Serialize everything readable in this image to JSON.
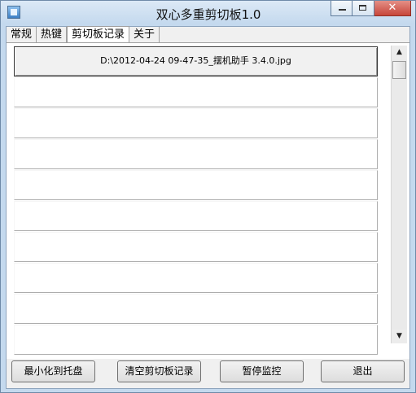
{
  "window": {
    "title": "双心多重剪切板1.0",
    "close_glyph": "✕"
  },
  "tabs": [
    {
      "label": "常规"
    },
    {
      "label": "热键"
    },
    {
      "label": "剪切板记录"
    },
    {
      "label": "关于"
    }
  ],
  "history": {
    "items": [
      "D:\\2012-04-24 09-47-35_摆机助手 3.4.0.jpg",
      "",
      "",
      "",
      "",
      "",
      "",
      "",
      "",
      ""
    ]
  },
  "scrollbar": {
    "up_glyph": "▲",
    "down_glyph": "▼"
  },
  "buttons": {
    "minimize_to_tray": "最小化到托盘",
    "clear_history": "清空剪切板记录",
    "pause_monitoring": "暂停监控",
    "exit": "退出"
  },
  "icons": [
    "app-icon",
    "minimize-icon",
    "maximize-icon",
    "close-icon",
    "scroll-up-icon",
    "scroll-down-icon"
  ]
}
